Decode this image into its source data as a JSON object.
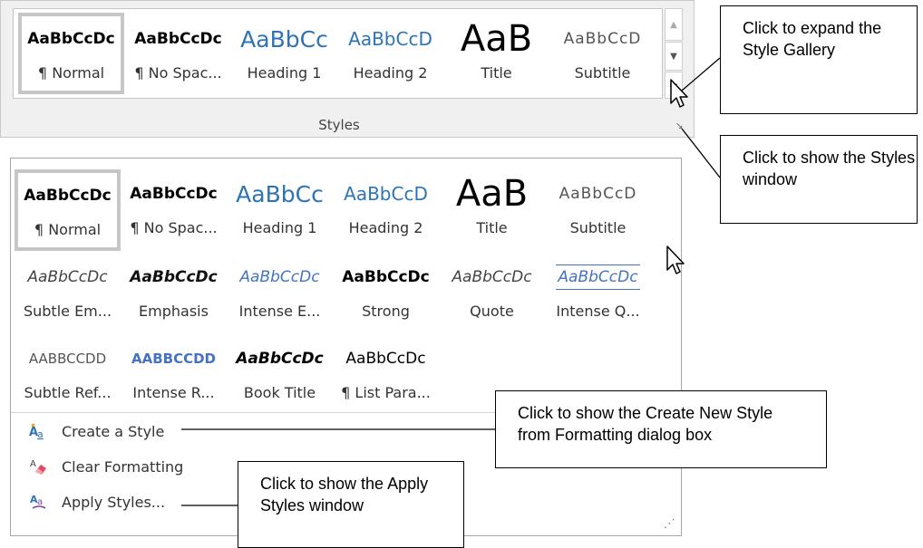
{
  "ribbon": {
    "group_label": "Styles",
    "gallery": [
      {
        "sample": "AaBbCcDc",
        "name": "¶ Normal"
      },
      {
        "sample": "AaBbCcDc",
        "name": "¶ No Spac..."
      },
      {
        "sample": "AaBbCc",
        "name": "Heading 1"
      },
      {
        "sample": "AaBbCcD",
        "name": "Heading 2"
      },
      {
        "sample": "AaB",
        "name": "Title"
      },
      {
        "sample": "AaBbCcD",
        "name": "Subtitle"
      }
    ],
    "scroll_up": "▲",
    "scroll_down": "▼",
    "more": "▬",
    "launcher": "↘"
  },
  "expanded": {
    "rows": [
      [
        {
          "sample": "AaBbCcDc",
          "name": "¶ Normal"
        },
        {
          "sample": "AaBbCcDc",
          "name": "¶ No Spac..."
        },
        {
          "sample": "AaBbCc",
          "name": "Heading 1"
        },
        {
          "sample": "AaBbCcD",
          "name": "Heading 2"
        },
        {
          "sample": "AaB",
          "name": "Title"
        },
        {
          "sample": "AaBbCcD",
          "name": "Subtitle"
        }
      ],
      [
        {
          "sample": "AaBbCcDc",
          "name": "Subtle Em..."
        },
        {
          "sample": "AaBbCcDc",
          "name": "Emphasis"
        },
        {
          "sample": "AaBbCcDc",
          "name": "Intense E..."
        },
        {
          "sample": "AaBbCcDc",
          "name": "Strong"
        },
        {
          "sample": "AaBbCcDc",
          "name": "Quote"
        },
        {
          "sample": "AaBbCcDc",
          "name": "Intense Q..."
        }
      ],
      [
        {
          "sample": "AABBCCDD",
          "name": "Subtle Ref..."
        },
        {
          "sample": "AABBCCDD",
          "name": "Intense R..."
        },
        {
          "sample": "AaBbCcDc",
          "name": "Book Title"
        },
        {
          "sample": "AaBbCcDc",
          "name": "¶ List Para..."
        }
      ]
    ],
    "commands": [
      {
        "label": "Create a Style",
        "icon": "new-style-icon"
      },
      {
        "label": "Clear Formatting",
        "icon": "eraser-icon"
      },
      {
        "label": "Apply Styles...",
        "icon": "apply-styles-icon"
      }
    ],
    "resize_grip": "⋰"
  },
  "callouts": {
    "expand": "Click to expand the Style Gallery",
    "styles_window": "Click to show the Styles window",
    "create_style": "Click to show the Create New Style from Formatting dialog box",
    "apply_styles": "Click to show the Apply Styles window"
  },
  "colors": {
    "heading_blue": "#2e74b5",
    "intense_blue": "#4472c4",
    "text_dark": "#333333"
  }
}
